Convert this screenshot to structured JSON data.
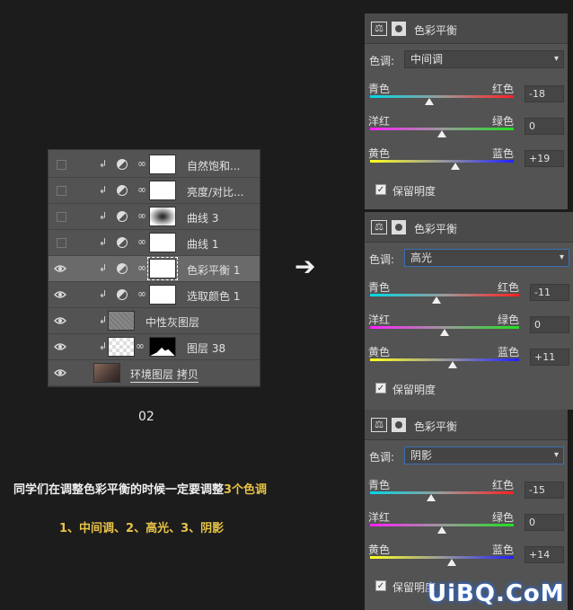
{
  "layers_panel": {
    "rows": [
      {
        "name": "自然饱和...",
        "visible": false,
        "type": "adjustment",
        "mask": "white"
      },
      {
        "name": "亮度/对比...",
        "visible": false,
        "type": "adjustment",
        "mask": "white"
      },
      {
        "name": "曲线 3",
        "visible": false,
        "type": "adjustment",
        "mask": "curve"
      },
      {
        "name": "曲线 1",
        "visible": false,
        "type": "adjustment",
        "mask": "white"
      },
      {
        "name": "色彩平衡 1",
        "visible": true,
        "type": "adjustment",
        "mask": "white",
        "selected": true
      },
      {
        "name": "选取颜色 1",
        "visible": true,
        "type": "adjustment",
        "mask": "white"
      },
      {
        "name": "中性灰图层",
        "visible": true,
        "type": "pixel",
        "mask": "noise"
      },
      {
        "name": "图层 38",
        "visible": true,
        "type": "pixel-masked",
        "mask": "checker"
      },
      {
        "name": "环境图层 拷贝",
        "visible": true,
        "type": "photo",
        "mask": "photo"
      }
    ]
  },
  "caption_number": "02",
  "arrow": "➔",
  "note_line1_prefix": "同学们在调整色彩平衡的时候一定要调整",
  "note_line1_highlight": "3个色调",
  "note_line2": "1、中间调、2、高光、3、阴影",
  "color_balance_panels": [
    {
      "title": "色彩平衡",
      "tone_label": "色调:",
      "tone_value": "中间调",
      "sliders": [
        {
          "left": "青色",
          "right": "红色",
          "value": "-18",
          "pos": -18
        },
        {
          "left": "洋红",
          "right": "绿色",
          "value": "0",
          "pos": 0
        },
        {
          "left": "黄色",
          "right": "蓝色",
          "value": "+19",
          "pos": 19
        }
      ],
      "preserve_label": "保留明度",
      "preserve_checked": true
    },
    {
      "title": "色彩平衡",
      "tone_label": "色调:",
      "tone_value": "高光",
      "sliders": [
        {
          "left": "青色",
          "right": "红色",
          "value": "-11",
          "pos": -11
        },
        {
          "left": "洋红",
          "right": "绿色",
          "value": "0",
          "pos": 0
        },
        {
          "left": "黄色",
          "right": "蓝色",
          "value": "+11",
          "pos": 11
        }
      ],
      "preserve_label": "保留明度",
      "preserve_checked": true
    },
    {
      "title": "色彩平衡",
      "tone_label": "色调:",
      "tone_value": "阴影",
      "sliders": [
        {
          "left": "青色",
          "right": "红色",
          "value": "-15",
          "pos": -15
        },
        {
          "left": "洋红",
          "right": "绿色",
          "value": "0",
          "pos": 0
        },
        {
          "left": "黄色",
          "right": "蓝色",
          "value": "+14",
          "pos": 14
        }
      ],
      "preserve_label": "保留明度",
      "preserve_checked": true
    }
  ],
  "watermark": "UiBQ.CoM"
}
